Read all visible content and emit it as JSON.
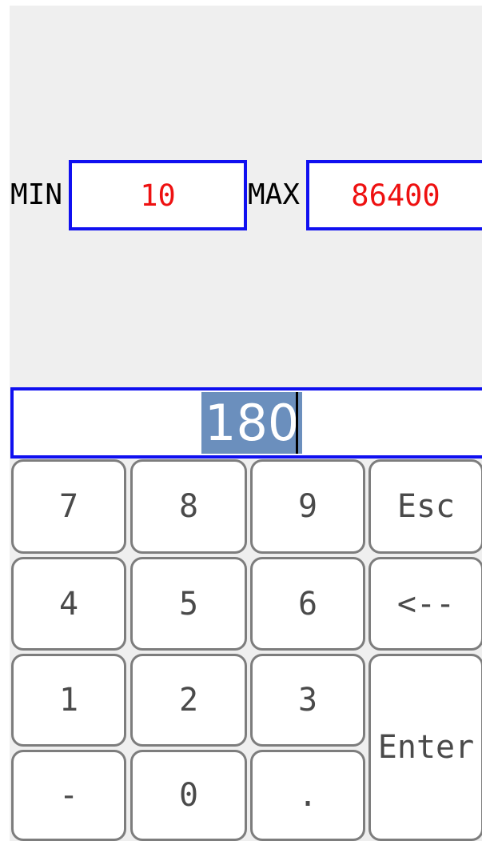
{
  "range": {
    "min_label": "MIN",
    "min_value": "10",
    "max_label": "MAX",
    "max_value": "86400"
  },
  "display": {
    "value": "180"
  },
  "keypad": {
    "k7": "7",
    "k8": "8",
    "k9": "9",
    "esc": "Esc",
    "k4": "4",
    "k5": "5",
    "k6": "6",
    "backspace": "<--",
    "k1": "1",
    "k2": "2",
    "k3": "3",
    "enter": "Enter",
    "minus": "-",
    "k0": "0",
    "dot": "."
  },
  "colors": {
    "border_blue": "#1010f0",
    "value_red": "#ee1111",
    "selection": "#6b8fbd",
    "panel": "#efefef",
    "key_border": "#7d7d7d"
  }
}
